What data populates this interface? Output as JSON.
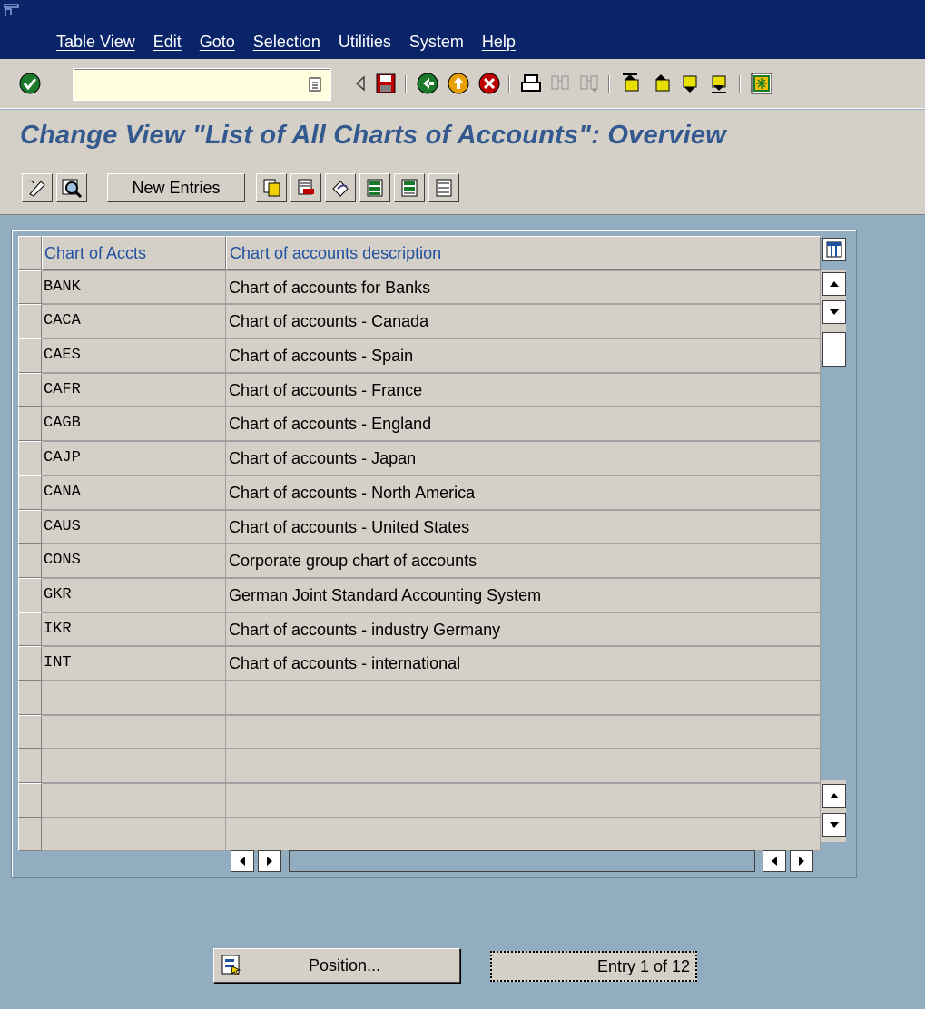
{
  "menubar": {
    "items": [
      {
        "label": "Table View",
        "underline": true
      },
      {
        "label": "Edit",
        "underline": true
      },
      {
        "label": "Goto",
        "underline": true
      },
      {
        "label": "Selection",
        "underline": true
      },
      {
        "label": "Utilities",
        "underline": false
      },
      {
        "label": "System",
        "underline": false
      },
      {
        "label": "Help",
        "underline": true
      }
    ]
  },
  "system_toolbar": {
    "command_field_value": "",
    "icons": [
      "enter-icon",
      "command-dropdown-icon",
      "back-arrow-icon",
      "save-icon",
      "back-icon",
      "exit-icon",
      "cancel-icon",
      "print-icon",
      "find-icon",
      "find-next-icon",
      "first-page-icon",
      "previous-page-icon",
      "next-page-icon",
      "last-page-icon",
      "layout-menu-icon"
    ]
  },
  "title": "Change View \"List of All Charts of Accounts\": Overview",
  "app_toolbar": {
    "new_entries_label": "New Entries",
    "icons": [
      "display-change-icon",
      "details-icon",
      "copy-as-icon",
      "delete-icon",
      "undo-change-icon",
      "select-all-icon",
      "select-block-icon",
      "deselect-all-icon"
    ]
  },
  "table": {
    "columns": [
      "Chart of Accts",
      "Chart of accounts description"
    ],
    "rows": [
      [
        "BANK",
        "Chart of accounts for Banks"
      ],
      [
        "CACA",
        "Chart of accounts - Canada"
      ],
      [
        "CAES",
        "Chart of accounts - Spain"
      ],
      [
        "CAFR",
        "Chart of accounts - France"
      ],
      [
        "CAGB",
        "Chart of accounts - England"
      ],
      [
        "CAJP",
        "Chart of accounts - Japan"
      ],
      [
        "CANA",
        "Chart of accounts - North America"
      ],
      [
        "CAUS",
        "Chart of accounts - United States"
      ],
      [
        "CONS",
        "Corporate group chart of accounts"
      ],
      [
        "GKR",
        "German Joint Standard Accounting System"
      ],
      [
        "IKR",
        "Chart of accounts - industry Germany"
      ],
      [
        "INT",
        "Chart of accounts - international"
      ],
      [
        "",
        ""
      ],
      [
        "",
        ""
      ],
      [
        "",
        ""
      ],
      [
        "",
        ""
      ],
      [
        "",
        ""
      ]
    ]
  },
  "bottom": {
    "position_label": "Position...",
    "entry_info": "Entry 1 of 12"
  },
  "colors": {
    "menubar_bg": "#0a246a",
    "panel_bg": "#d4d0c8",
    "screen_bg": "#93adc0",
    "title_color": "#34598f",
    "header_text": "#1f4fa0"
  }
}
